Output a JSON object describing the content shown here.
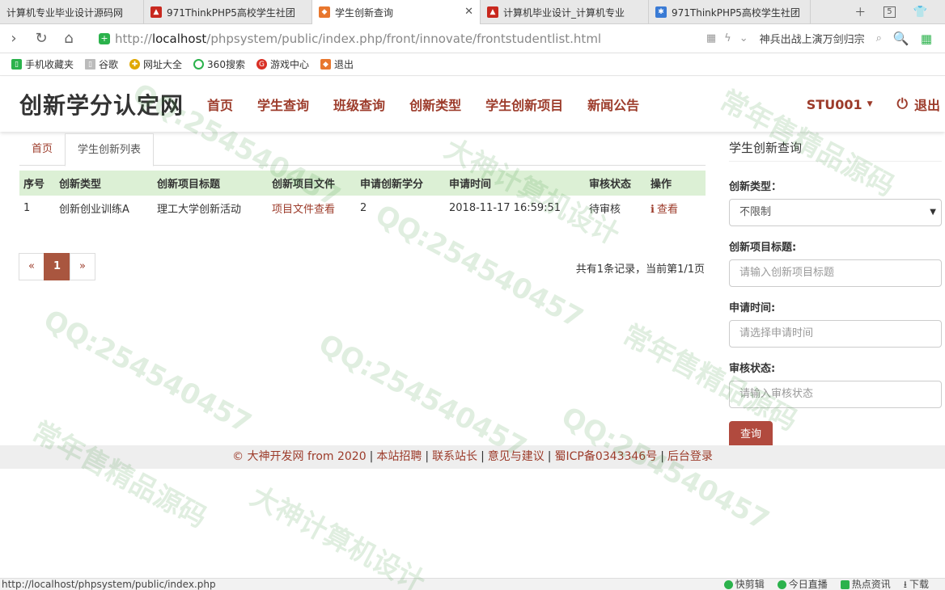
{
  "browser": {
    "tabs": [
      {
        "title": "计算机专业毕业设计源码网",
        "active": false
      },
      {
        "title": "971ThinkPHP5高校学生社团",
        "active": false
      },
      {
        "title": "学生创新查询",
        "active": true
      },
      {
        "title": "计算机毕业设计_计算机专业",
        "active": false
      },
      {
        "title": "971ThinkPHP5高校学生社团",
        "active": false
      }
    ],
    "tab_count": "5",
    "url_prefix": "http://",
    "url_host": "localhost",
    "url_path": "/phpsystem/public/index.php/front/innovate/frontstudentlist.html",
    "search_hint": "神兵出战上演万剑归宗",
    "bookmarks": [
      {
        "label": "手机收藏夹",
        "icon": "phone-icon",
        "color": "#2bb24c"
      },
      {
        "label": "谷歌",
        "icon": "page-icon",
        "color": "#999999"
      },
      {
        "label": "网址大全",
        "icon": "globe-icon",
        "color": "#e0a800"
      },
      {
        "label": "360搜索",
        "icon": "search360-icon",
        "color": "#2bb24c"
      },
      {
        "label": "游戏中心",
        "icon": "game-icon",
        "color": "#d93025"
      },
      {
        "label": "退出",
        "icon": "exit-icon",
        "color": "#e8772e"
      }
    ]
  },
  "site": {
    "brand": "创新学分认定网",
    "nav": [
      "首页",
      "学生查询",
      "班级查询",
      "创新类型",
      "学生创新项目",
      "新闻公告"
    ],
    "user": "STU001",
    "logout": "退出",
    "accent": "#9c3b2a"
  },
  "content_tabs": [
    "首页",
    "学生创新列表"
  ],
  "table": {
    "headers": [
      "序号",
      "创新类型",
      "创新项目标题",
      "创新项目文件",
      "申请创新学分",
      "申请时间",
      "审核状态",
      "操作"
    ],
    "rows": [
      {
        "no": "1",
        "type": "创新创业训练A",
        "title": "理工大学创新活动",
        "file": "项目文件查看",
        "credit": "2",
        "time": "2018-11-17 16:59:51",
        "status": "待审核",
        "action": "查看"
      }
    ]
  },
  "pager": {
    "prev": "«",
    "current": "1",
    "next": "»",
    "info": "共有1条记录，当前第1/1页"
  },
  "sidebar": {
    "title": "学生创新查询",
    "type_label": "创新类型：",
    "type_value": "不限制",
    "title_label": "创新项目标题:",
    "title_placeholder": "请输入创新项目标题",
    "time_label": "申请时间:",
    "time_placeholder": "请选择申请时间",
    "status_label": "审核状态:",
    "status_placeholder": "请输入审核状态",
    "button": "查询"
  },
  "footer": {
    "copyright": "© 大神开发网 from 2020",
    "links": [
      "本站招聘",
      "联系站长",
      "意见与建议",
      "蜀ICP备0343346号",
      "后台登录"
    ]
  },
  "statusbar": {
    "url": "http://localhost/phpsystem/public/index.php",
    "items": [
      "快剪辑",
      "今日直播",
      "热点资讯",
      "下载"
    ]
  },
  "watermarks": [
    "QQ:254540457",
    "大神计算机设计",
    "常年售精品源码"
  ]
}
